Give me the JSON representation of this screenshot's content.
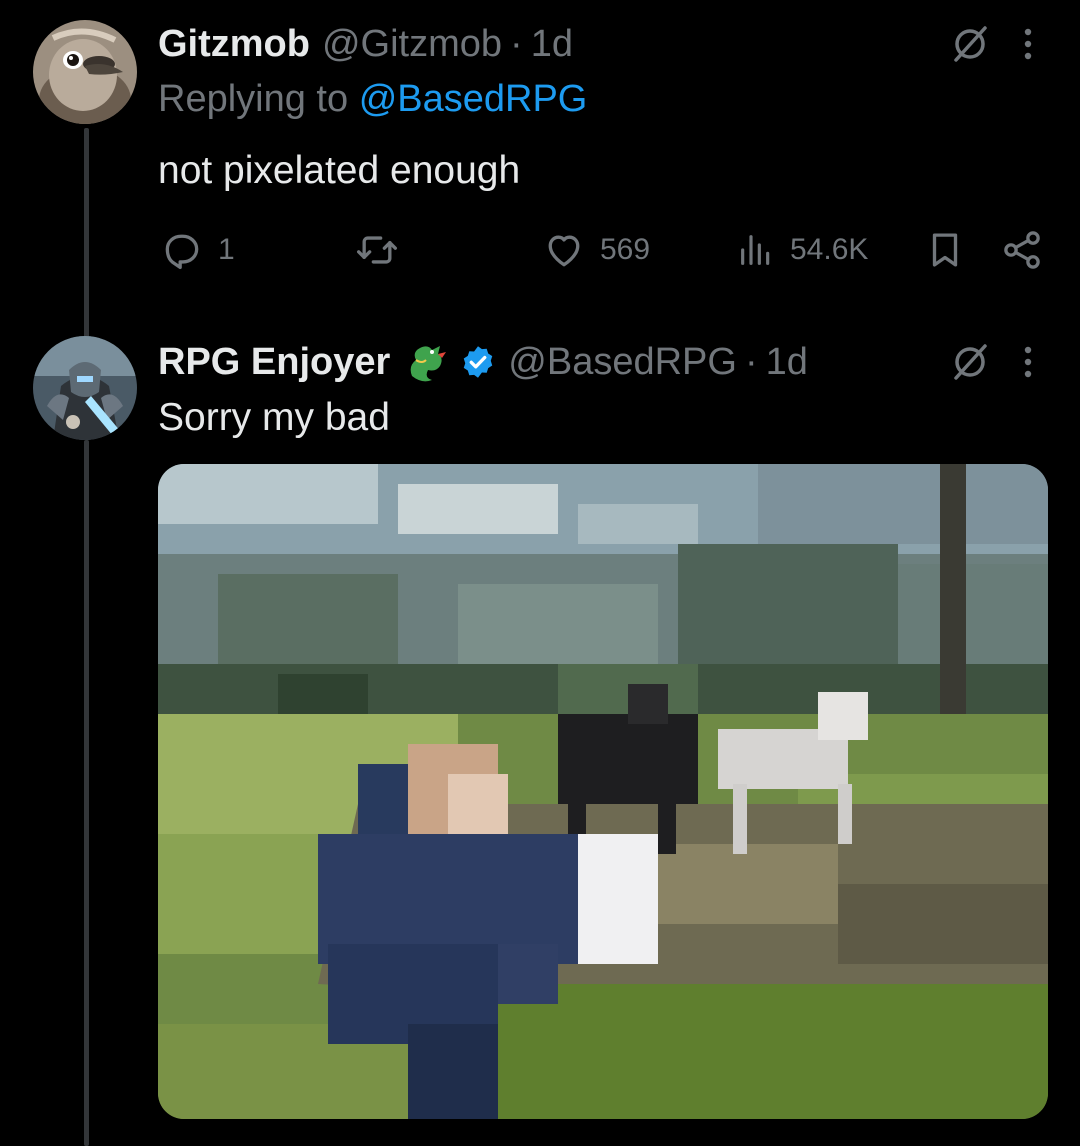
{
  "reply1": {
    "display_name": "Gitzmob",
    "handle": "@Gitzmob",
    "separator": "·",
    "time": "1d",
    "replying_prefix": "Replying to",
    "replying_handle": "@BasedRPG",
    "text": "not pixelated enough",
    "avatar_icon": "ostrich-avatar",
    "actions": {
      "replies": "1",
      "reposts": "",
      "likes": "569",
      "views": "54.6K"
    }
  },
  "reply2": {
    "display_name": "RPG Enjoyer",
    "emoji": "🐉",
    "verified": true,
    "handle": "@BasedRPG",
    "separator": "·",
    "time": "1d",
    "text": "Sorry my bad",
    "avatar_icon": "armored-knight-avatar",
    "media_description_icon": "pixelated-game-screenshot-image"
  },
  "colors": {
    "background": "#000000",
    "text_primary": "#e7e9ea",
    "text_secondary": "#71767b",
    "accent": "#1d9bf0",
    "thread_line": "#333639"
  }
}
